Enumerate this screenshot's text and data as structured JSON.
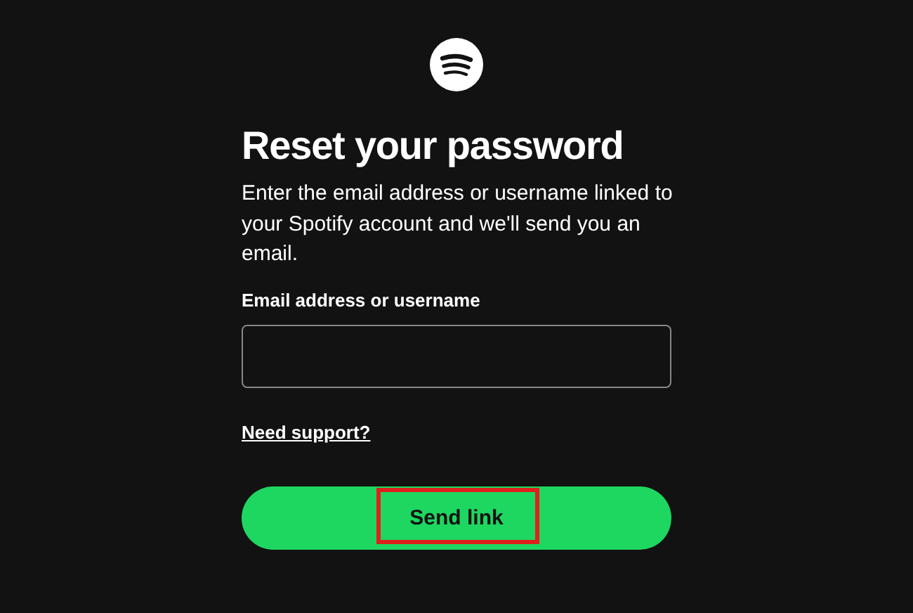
{
  "title": "Reset your password",
  "description": "Enter the email address or username linked to your Spotify account and we'll send you an email.",
  "field": {
    "label": "Email address or username"
  },
  "support_link": "Need support?",
  "button": {
    "label": "Send link",
    "highlighted": true
  }
}
